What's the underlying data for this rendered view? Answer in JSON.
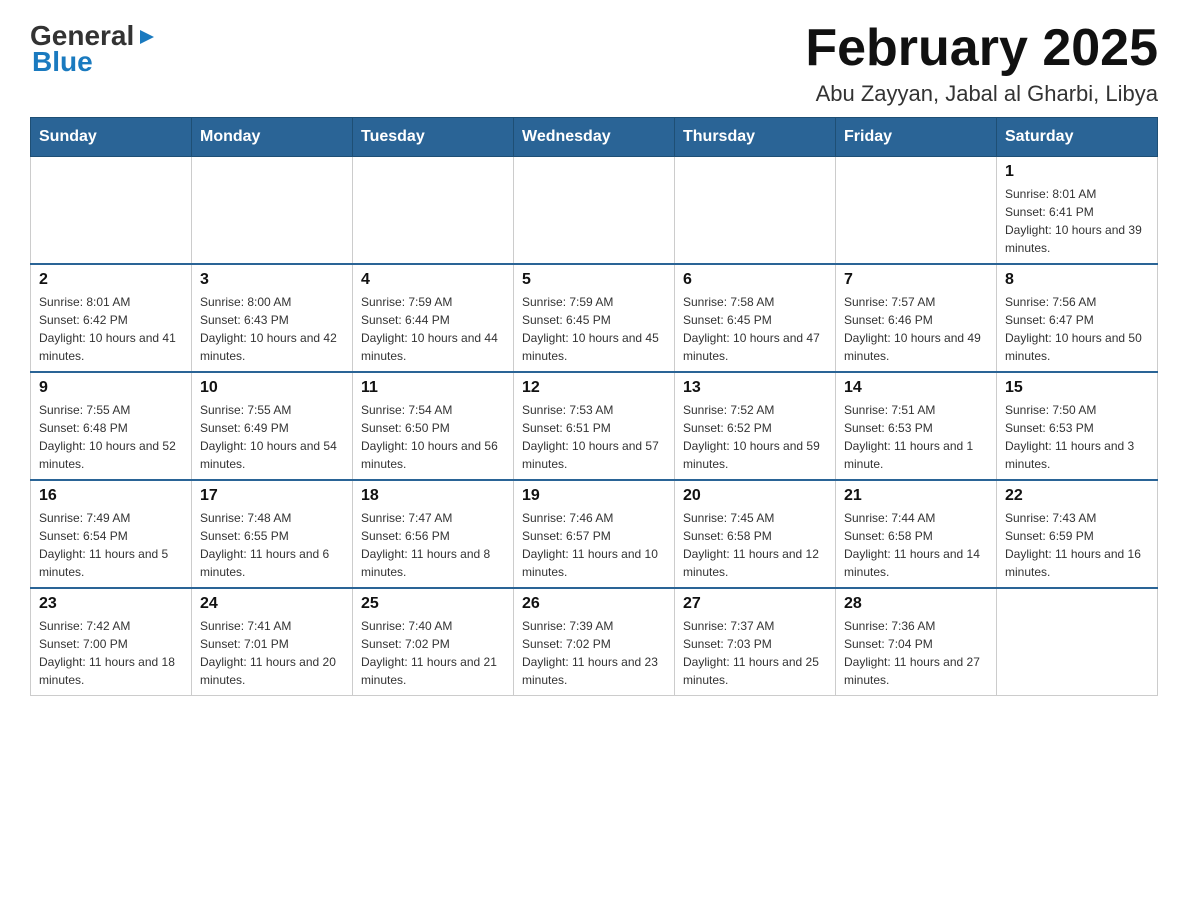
{
  "logo": {
    "text_general": "General",
    "text_blue": "Blue",
    "arrow": "▶"
  },
  "title": "February 2025",
  "subtitle": "Abu Zayyan, Jabal al Gharbi, Libya",
  "days_of_week": [
    "Sunday",
    "Monday",
    "Tuesday",
    "Wednesday",
    "Thursday",
    "Friday",
    "Saturday"
  ],
  "weeks": [
    [
      {
        "day": "",
        "info": ""
      },
      {
        "day": "",
        "info": ""
      },
      {
        "day": "",
        "info": ""
      },
      {
        "day": "",
        "info": ""
      },
      {
        "day": "",
        "info": ""
      },
      {
        "day": "",
        "info": ""
      },
      {
        "day": "1",
        "info": "Sunrise: 8:01 AM\nSunset: 6:41 PM\nDaylight: 10 hours and 39 minutes."
      }
    ],
    [
      {
        "day": "2",
        "info": "Sunrise: 8:01 AM\nSunset: 6:42 PM\nDaylight: 10 hours and 41 minutes."
      },
      {
        "day": "3",
        "info": "Sunrise: 8:00 AM\nSunset: 6:43 PM\nDaylight: 10 hours and 42 minutes."
      },
      {
        "day": "4",
        "info": "Sunrise: 7:59 AM\nSunset: 6:44 PM\nDaylight: 10 hours and 44 minutes."
      },
      {
        "day": "5",
        "info": "Sunrise: 7:59 AM\nSunset: 6:45 PM\nDaylight: 10 hours and 45 minutes."
      },
      {
        "day": "6",
        "info": "Sunrise: 7:58 AM\nSunset: 6:45 PM\nDaylight: 10 hours and 47 minutes."
      },
      {
        "day": "7",
        "info": "Sunrise: 7:57 AM\nSunset: 6:46 PM\nDaylight: 10 hours and 49 minutes."
      },
      {
        "day": "8",
        "info": "Sunrise: 7:56 AM\nSunset: 6:47 PM\nDaylight: 10 hours and 50 minutes."
      }
    ],
    [
      {
        "day": "9",
        "info": "Sunrise: 7:55 AM\nSunset: 6:48 PM\nDaylight: 10 hours and 52 minutes."
      },
      {
        "day": "10",
        "info": "Sunrise: 7:55 AM\nSunset: 6:49 PM\nDaylight: 10 hours and 54 minutes."
      },
      {
        "day": "11",
        "info": "Sunrise: 7:54 AM\nSunset: 6:50 PM\nDaylight: 10 hours and 56 minutes."
      },
      {
        "day": "12",
        "info": "Sunrise: 7:53 AM\nSunset: 6:51 PM\nDaylight: 10 hours and 57 minutes."
      },
      {
        "day": "13",
        "info": "Sunrise: 7:52 AM\nSunset: 6:52 PM\nDaylight: 10 hours and 59 minutes."
      },
      {
        "day": "14",
        "info": "Sunrise: 7:51 AM\nSunset: 6:53 PM\nDaylight: 11 hours and 1 minute."
      },
      {
        "day": "15",
        "info": "Sunrise: 7:50 AM\nSunset: 6:53 PM\nDaylight: 11 hours and 3 minutes."
      }
    ],
    [
      {
        "day": "16",
        "info": "Sunrise: 7:49 AM\nSunset: 6:54 PM\nDaylight: 11 hours and 5 minutes."
      },
      {
        "day": "17",
        "info": "Sunrise: 7:48 AM\nSunset: 6:55 PM\nDaylight: 11 hours and 6 minutes."
      },
      {
        "day": "18",
        "info": "Sunrise: 7:47 AM\nSunset: 6:56 PM\nDaylight: 11 hours and 8 minutes."
      },
      {
        "day": "19",
        "info": "Sunrise: 7:46 AM\nSunset: 6:57 PM\nDaylight: 11 hours and 10 minutes."
      },
      {
        "day": "20",
        "info": "Sunrise: 7:45 AM\nSunset: 6:58 PM\nDaylight: 11 hours and 12 minutes."
      },
      {
        "day": "21",
        "info": "Sunrise: 7:44 AM\nSunset: 6:58 PM\nDaylight: 11 hours and 14 minutes."
      },
      {
        "day": "22",
        "info": "Sunrise: 7:43 AM\nSunset: 6:59 PM\nDaylight: 11 hours and 16 minutes."
      }
    ],
    [
      {
        "day": "23",
        "info": "Sunrise: 7:42 AM\nSunset: 7:00 PM\nDaylight: 11 hours and 18 minutes."
      },
      {
        "day": "24",
        "info": "Sunrise: 7:41 AM\nSunset: 7:01 PM\nDaylight: 11 hours and 20 minutes."
      },
      {
        "day": "25",
        "info": "Sunrise: 7:40 AM\nSunset: 7:02 PM\nDaylight: 11 hours and 21 minutes."
      },
      {
        "day": "26",
        "info": "Sunrise: 7:39 AM\nSunset: 7:02 PM\nDaylight: 11 hours and 23 minutes."
      },
      {
        "day": "27",
        "info": "Sunrise: 7:37 AM\nSunset: 7:03 PM\nDaylight: 11 hours and 25 minutes."
      },
      {
        "day": "28",
        "info": "Sunrise: 7:36 AM\nSunset: 7:04 PM\nDaylight: 11 hours and 27 minutes."
      },
      {
        "day": "",
        "info": ""
      }
    ]
  ]
}
